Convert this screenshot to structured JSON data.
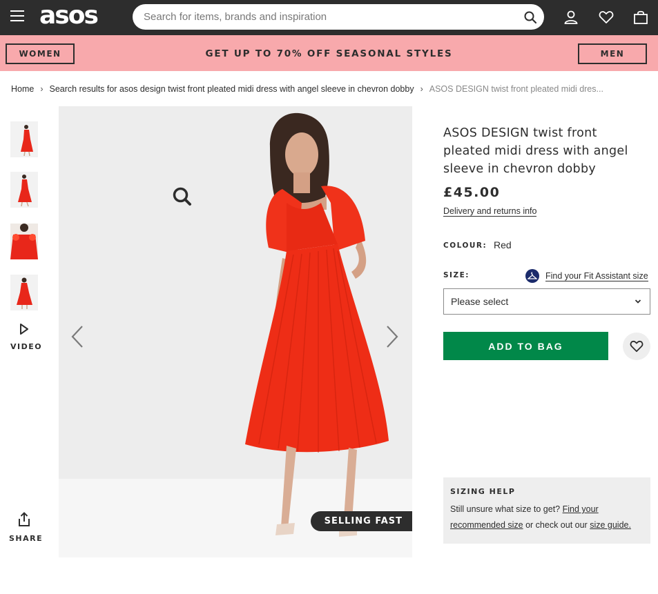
{
  "header": {
    "logo": "asos",
    "search_placeholder": "Search for items, brands and inspiration"
  },
  "promo": {
    "women_label": "WOMEN",
    "men_label": "MEN",
    "text": "GET UP TO 70% OFF SEASONAL STYLES",
    "bg_color": "#f8a9ac"
  },
  "breadcrumb": {
    "home": "Home",
    "search": "Search results for asos design twist front pleated midi dress with angel sleeve in chevron dobby",
    "current": "ASOS DESIGN twist front pleated midi dres..."
  },
  "gallery": {
    "video_label": "VIDEO",
    "share_label": "SHARE",
    "badge": "SELLING FAST"
  },
  "product": {
    "title": "ASOS DESIGN twist front pleated midi dress with angel sleeve in chevron dobby",
    "price": "£45.00",
    "delivery_link": "Delivery and returns info",
    "colour_label": "COLOUR:",
    "colour_value": "Red",
    "size_label": "SIZE:",
    "fit_assistant": "Find your Fit Assistant size",
    "size_select_value": "Please select",
    "add_to_bag": "ADD TO BAG",
    "accent_color": "#018849"
  },
  "sizing_help": {
    "title": "SIZING HELP",
    "text1": "Still unsure what size to get? ",
    "link1": "Find your recommended size",
    "text2": " or check out our ",
    "link2": "size guide."
  }
}
